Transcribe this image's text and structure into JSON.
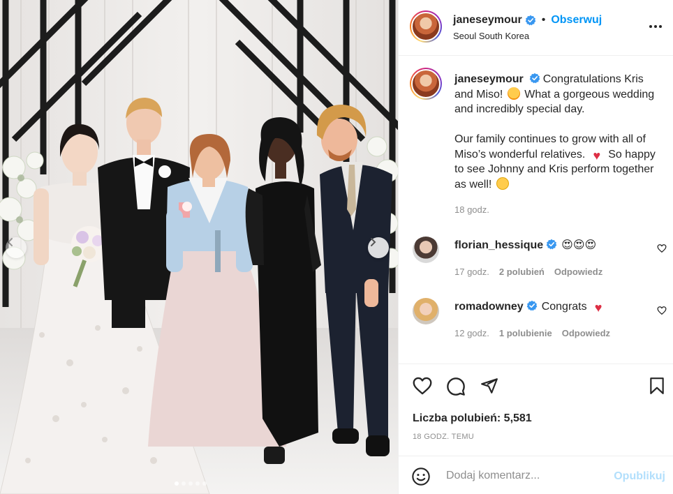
{
  "post": {
    "username": "janeseymour",
    "verified": true,
    "follow_label": "Obserwuj",
    "separator": "•",
    "location": "Seoul South Korea",
    "more_icon": "more-horizontal-icon"
  },
  "caption": {
    "username": "janeseymour",
    "line1": "Congratulations Kris and Miso!",
    "line2": "What a gorgeous wedding and incredibly special day.",
    "line3": "Our family continues to grow with all of Miso’s wonderful relatives.",
    "line4": "So happy to see Johnny and Kris perform together as well!",
    "time": "18 godz."
  },
  "comments": [
    {
      "username": "florian_hessique",
      "verified": true,
      "text": "😍😍😍",
      "time": "17 godz.",
      "likes": "2 polubień",
      "reply": "Odpowiedz"
    },
    {
      "username": "romadowney",
      "verified": true,
      "text": "Congrats",
      "time": "12 godz.",
      "likes": "1 polubienie",
      "reply": "Odpowiedz"
    }
  ],
  "actions": {
    "likes_label": "Liczba polubień: 5,581",
    "timestamp": "18 GODZ. TEMU"
  },
  "add_comment": {
    "placeholder": "Dodaj komentarz...",
    "publish_label": "Opublikuj"
  },
  "carousel": {
    "slides": 5,
    "active_slide": 1
  },
  "colors": {
    "link_blue": "#0095f6",
    "publish_disabled": "#b2dffc",
    "secondary_text": "#8e8e8e",
    "verified_blue": "#3897f0",
    "heart_red": "#dd2e44"
  }
}
